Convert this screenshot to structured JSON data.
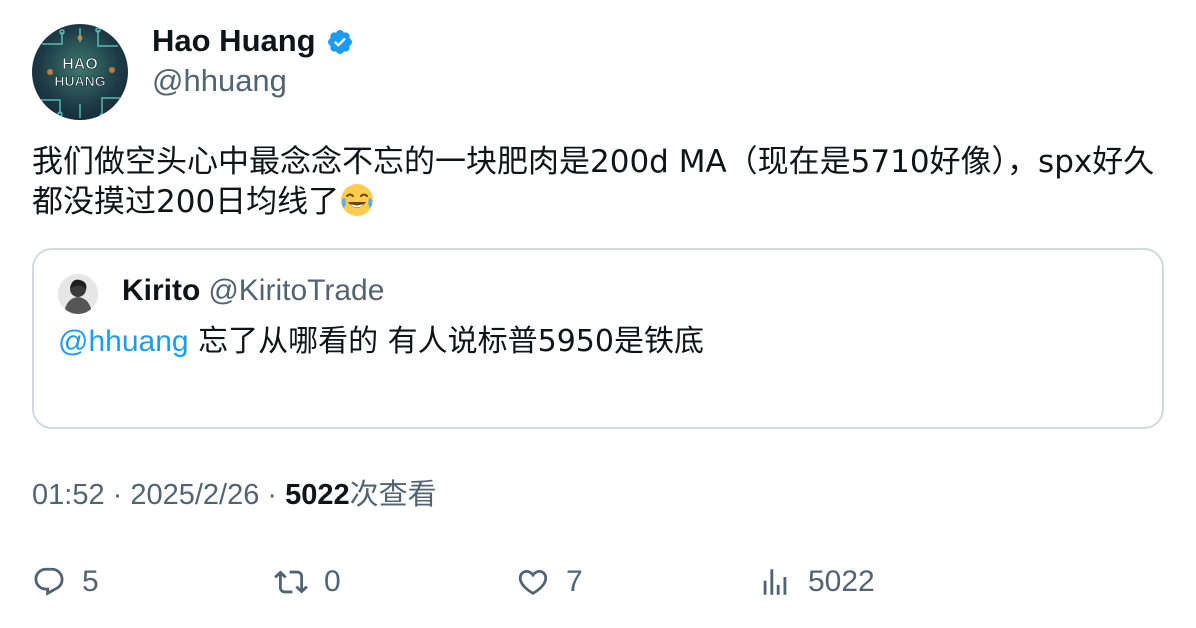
{
  "author": {
    "name": "Hao Huang",
    "handle": "@hhuang",
    "avatar_text_line1": "HAO",
    "avatar_text_line2": "HUANG",
    "verified": true
  },
  "tweet": {
    "text": "我们做空头心中最念念不忘的一块肥肉是200d MA（现在是5710好像），spx好久都没摸过200日均线了",
    "emoji": "face-with-tears-of-joy"
  },
  "quote": {
    "name": "Kirito",
    "handle": "@KiritoTrade",
    "mention": "@hhuang",
    "text": " 忘了从哪看的 有人说标普5950是铁底"
  },
  "meta": {
    "time": "01:52",
    "separator": " · ",
    "date": "2025/2/26",
    "views_count": "5022",
    "views_label": "次查看"
  },
  "actions": {
    "replies": "5",
    "retweets": "0",
    "likes": "7",
    "views": "5022"
  },
  "colors": {
    "accent": "#1d9bf0",
    "secondary_text": "#536471",
    "border": "#cfd9de"
  }
}
